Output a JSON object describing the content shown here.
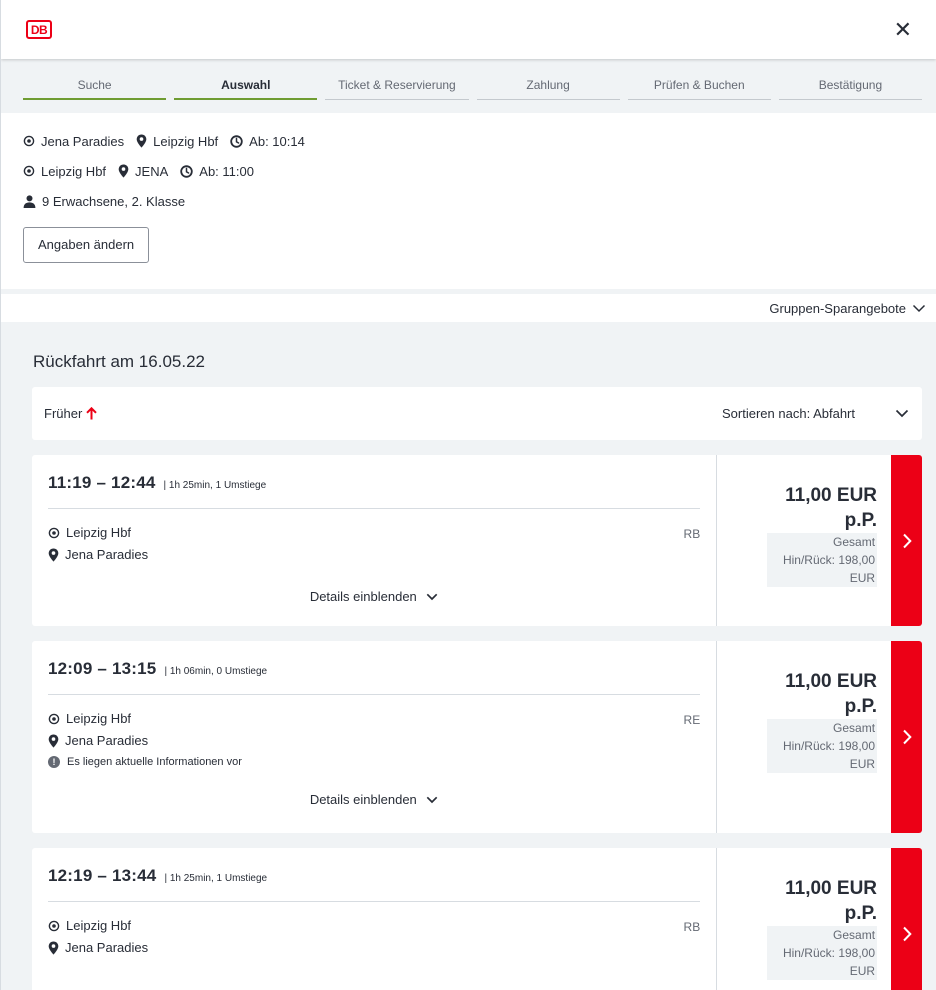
{
  "header": {
    "logo_text": "DB",
    "close_symbol": "✕"
  },
  "stepper": {
    "steps": [
      {
        "label": "Suche"
      },
      {
        "label": "Auswahl"
      },
      {
        "label": "Ticket & Reservierung"
      },
      {
        "label": "Zahlung"
      },
      {
        "label": "Prüfen & Buchen"
      },
      {
        "label": "Bestätigung"
      }
    ]
  },
  "summary": {
    "outbound": {
      "from": "Jena Paradies",
      "to": "Leipzig Hbf",
      "departure": "Ab: 10:14"
    },
    "return": {
      "from": "Leipzig Hbf",
      "to": "JENA",
      "departure": "Ab: 11:00"
    },
    "passengers": "9 Erwachsene, 2. Klasse",
    "edit_label": "Angaben ändern"
  },
  "group_offers_label": "Gruppen-Sparangebote",
  "return_title": "Rückfahrt am 16.05.22",
  "sort_bar": {
    "earlier_label": "Früher",
    "sort_label": "Sortieren nach: Abfahrt"
  },
  "connections": [
    {
      "times": "11:19 – 12:44",
      "meta": "| 1h 25min, 1 Umstiege",
      "from": "Leipzig Hbf",
      "to": "Jena Paradies",
      "train": "RB",
      "info": "",
      "details_label": "Details einblenden",
      "price_line1": "11,00 EUR",
      "price_line2": "p.P.",
      "total_line1": "Gesamt",
      "total_line2": "Hin/Rück: 198,00",
      "total_line3": "EUR"
    },
    {
      "times": "12:09 – 13:15",
      "meta": "| 1h 06min, 0 Umstiege",
      "from": "Leipzig Hbf",
      "to": "Jena Paradies",
      "train": "RE",
      "info": "Es liegen aktuelle Informationen vor",
      "details_label": "Details einblenden",
      "price_line1": "11,00 EUR",
      "price_line2": "p.P.",
      "total_line1": "Gesamt",
      "total_line2": "Hin/Rück: 198,00",
      "total_line3": "EUR"
    },
    {
      "times": "12:19 – 13:44",
      "meta": "| 1h 25min, 1 Umstiege",
      "from": "Leipzig Hbf",
      "to": "Jena Paradies",
      "train": "RB",
      "info": "",
      "details_label": "Details einblenden",
      "price_line1": "11,00 EUR",
      "price_line2": "p.P.",
      "total_line1": "Gesamt",
      "total_line2": "Hin/Rück: 198,00",
      "total_line3": "EUR"
    }
  ],
  "colors": {
    "brand_red": "#ec0016",
    "step_green": "#6f9c32",
    "text": "#282d37",
    "muted": "#646973"
  }
}
